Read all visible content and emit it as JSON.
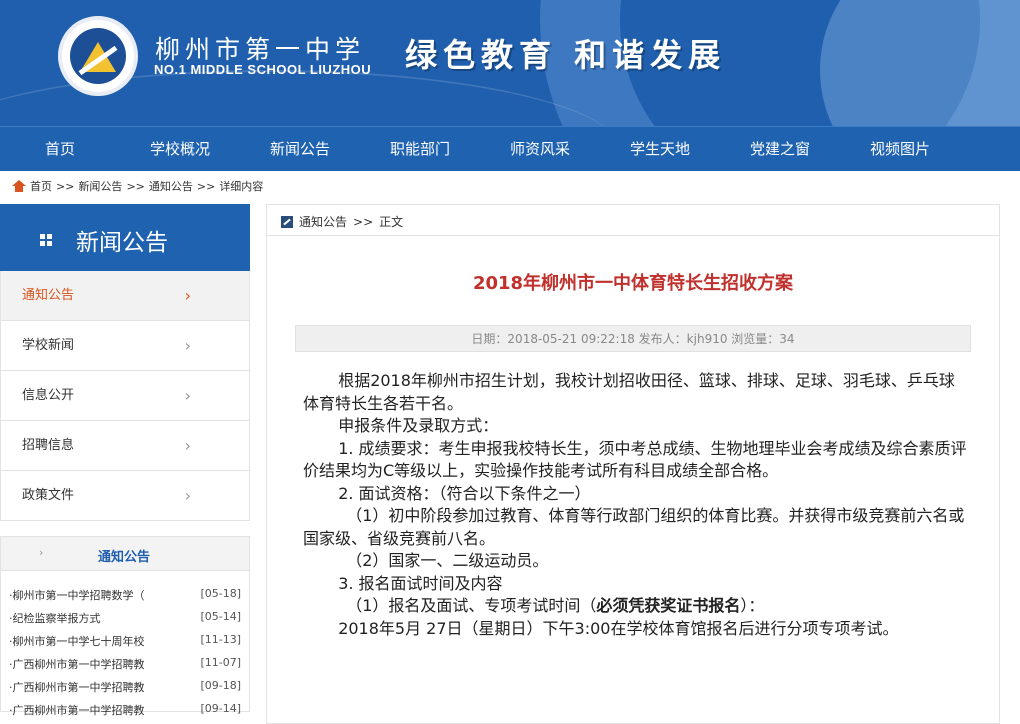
{
  "header": {
    "school_name_cn": "柳州市第一中学",
    "school_name_en": "NO.1 MIDDLE SCHOOL LIUZHOU",
    "motto": "绿色教育  和谐发展"
  },
  "nav": {
    "items": [
      "首页",
      "学校概况",
      "新闻公告",
      "职能部门",
      "师资风采",
      "学生天地",
      "党建之窗",
      "视频图片"
    ]
  },
  "breadcrumb": {
    "home": "首页",
    "sep": ">>",
    "level1": "新闻公告",
    "level2": "通知公告",
    "level3": "详细内容"
  },
  "sidebar": {
    "title": "新闻公告",
    "items": [
      {
        "label": "通知公告",
        "active": true
      },
      {
        "label": "学校新闻",
        "active": false
      },
      {
        "label": "信息公开",
        "active": false
      },
      {
        "label": "招聘信息",
        "active": false
      },
      {
        "label": "政策文件",
        "active": false
      }
    ],
    "notice_title": "通知公告",
    "notices": [
      {
        "title": "·柳州市第一中学招聘数学（",
        "date": "[05-18]"
      },
      {
        "title": "·纪检监察举报方式",
        "date": "[05-14]"
      },
      {
        "title": "·柳州市第一中学七十周年校",
        "date": "[11-13]"
      },
      {
        "title": "·广西柳州市第一中学招聘教",
        "date": "[11-07]"
      },
      {
        "title": "·广西柳州市第一中学招聘教",
        "date": "[09-18]"
      },
      {
        "title": "·广西柳州市第一中学招聘教",
        "date": "[09-14]"
      }
    ]
  },
  "main": {
    "crumb_section": "通知公告",
    "crumb_sep": ">>",
    "crumb_page": "正文",
    "title": "2018年柳州市一中体育特长生招收方案",
    "meta": "日期：2018-05-21 09:22:18  发布人：kjh910  浏览量：34",
    "paragraphs": {
      "p1": "根据2018年柳州市招生计划，我校计划招收田径、篮球、排球、足球、羽毛球、乒乓球体育特长生各若干名。",
      "p2": "申报条件及录取方式：",
      "p3": "1. 成绩要求：考生申报我校特长生，须中考总成绩、生物地理毕业会考成绩及综合素质评价结果均为C等级以上，实验操作技能考试所有科目成绩全部合格。",
      "p4": "2. 面试资格：（符合以下条件之一）",
      "p5": "（1）初中阶段参加过教育、体育等行政部门组织的体育比赛。并获得市级竞赛前六名或国家级、省级竞赛前八名。",
      "p6": "（2）国家一、二级运动员。",
      "p7": "3. 报名面试时间及内容",
      "p8a": "（1）报名及面试、专项考试时间（",
      "p8b": "必须凭获奖证书报名",
      "p8c": "）：",
      "p9": "2018年5月 27日（星期日）下午3:00在学校体育馆报名后进行分项专项考试。"
    }
  },
  "colors": {
    "brand_blue": "#1e62b0",
    "accent_orange": "#d9531e",
    "title_red": "#c0302c"
  }
}
